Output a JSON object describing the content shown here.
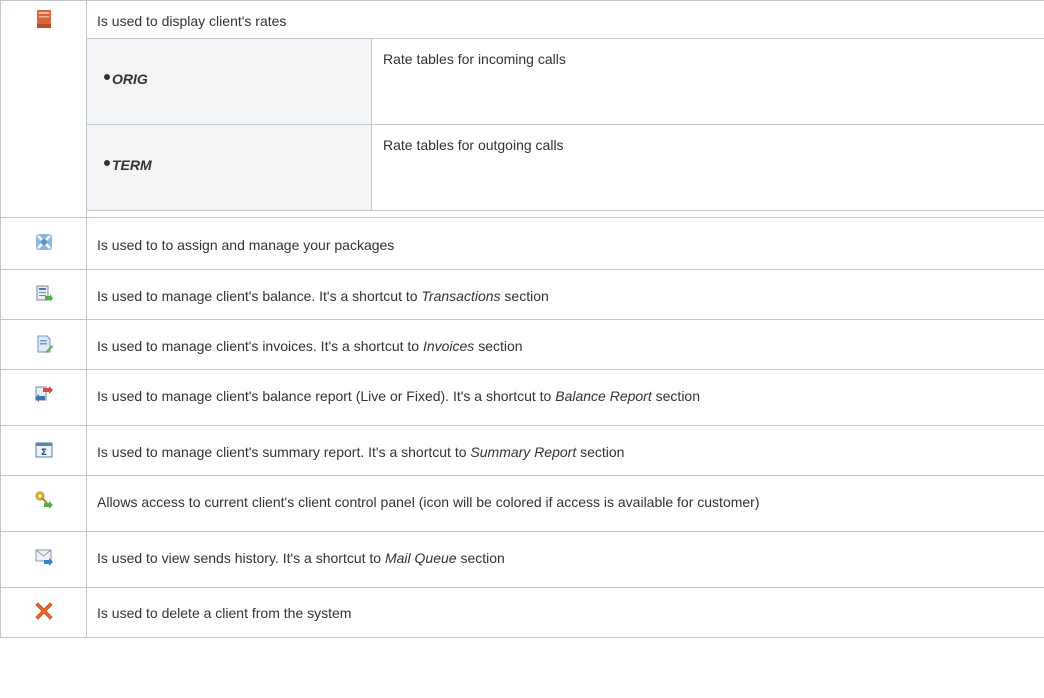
{
  "rows": [
    {
      "icon": "rates-book-icon",
      "text": "Is used to display client's rates",
      "sub": [
        {
          "name": "ORIG",
          "desc": "Rate tables for incoming calls"
        },
        {
          "name": "TERM",
          "desc": "Rate tables for outgoing calls"
        }
      ]
    },
    {
      "icon": "packages-icon",
      "text": "Is used to to assign and manage your packages"
    },
    {
      "icon": "balance-icon",
      "before": "Is used to manage client's balance. It's a shortcut to ",
      "link": "Transactions",
      "after": " section"
    },
    {
      "icon": "invoices-icon",
      "before": "Is used to manage client's invoices. It's a shortcut to ",
      "link": "Invoices",
      "after": " section"
    },
    {
      "icon": "balance-report-icon",
      "before": "Is used to manage client's balance report (Live or Fixed). It's a shortcut to ",
      "link": "Balance Report",
      "after": " section"
    },
    {
      "icon": "summary-report-icon",
      "before": "Is used to manage client's summary report. It's a shortcut to ",
      "link": "Summary Report",
      "after": " section"
    },
    {
      "icon": "key-access-icon",
      "text": "Allows access to current client's client control panel (icon will be colored if access is available for customer)"
    },
    {
      "icon": "mail-history-icon",
      "before": "Is used to view sends history. It's a shortcut to ",
      "link": "Mail Queue",
      "after": " section"
    },
    {
      "icon": "delete-client-icon",
      "text": "Is used to delete a client from the system"
    }
  ]
}
